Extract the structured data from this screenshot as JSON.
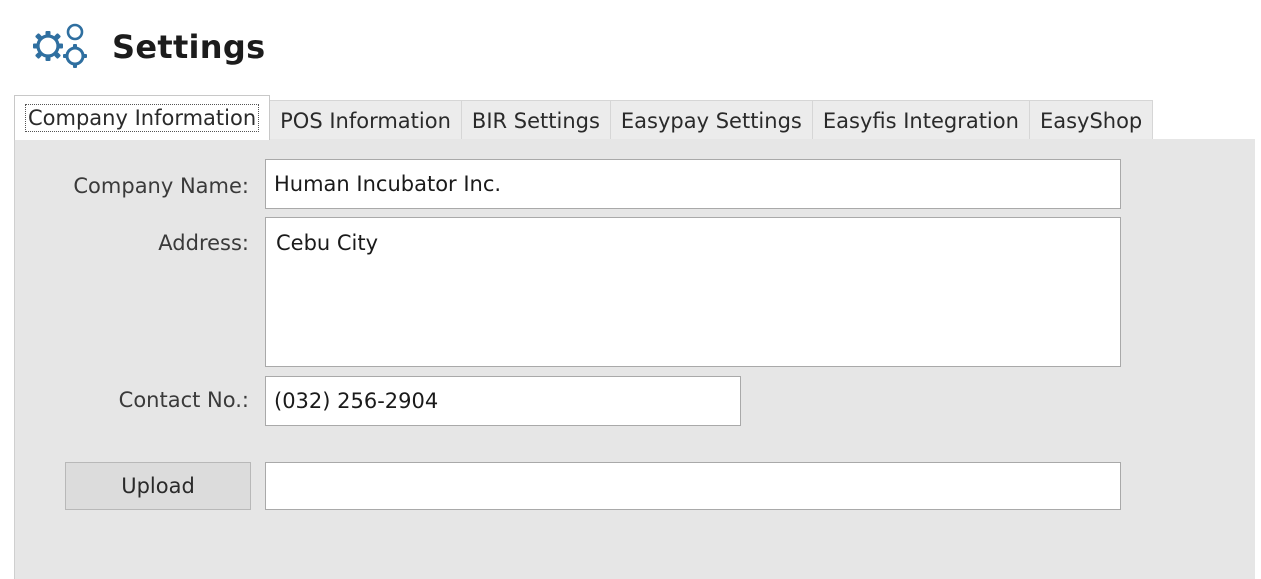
{
  "header": {
    "title": "Settings",
    "icon": "gears-icon",
    "icon_color": "#2f6fa0"
  },
  "tabs": [
    {
      "label": "Company Information",
      "active": true
    },
    {
      "label": "POS Information",
      "active": false
    },
    {
      "label": "BIR Settings",
      "active": false
    },
    {
      "label": "Easypay Settings",
      "active": false
    },
    {
      "label": "Easyfis Integration",
      "active": false
    },
    {
      "label": "EasyShop",
      "active": false
    }
  ],
  "form": {
    "company_name_label": "Company Name:",
    "company_name_value": "Human Incubator Inc.",
    "address_label": "Address:",
    "address_value": "Cebu City",
    "contact_label": "Contact No.:",
    "contact_value": "(032) 256-2904",
    "upload_label": "Upload",
    "upload_path_value": ""
  },
  "colors": {
    "panel_background": "#e6e6e6",
    "tab_background": "#ececec",
    "accent": "#2f6fa0"
  }
}
